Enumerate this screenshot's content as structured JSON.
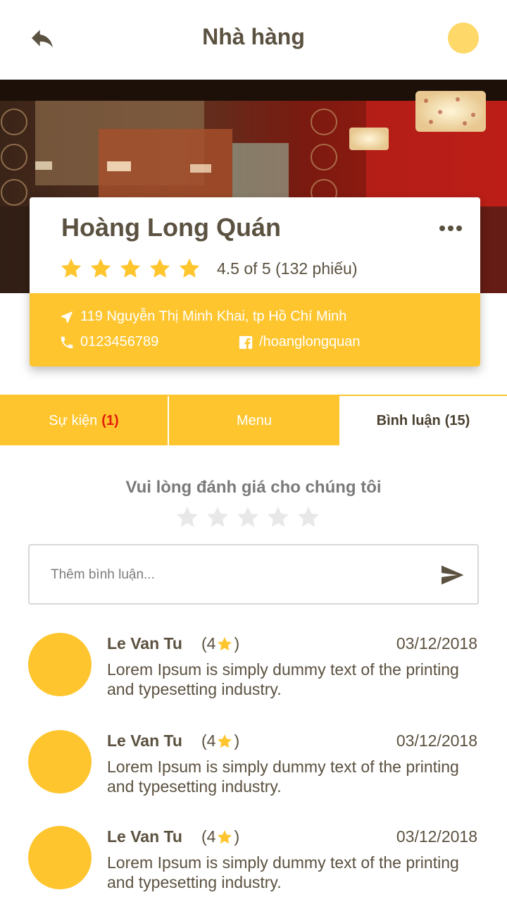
{
  "header": {
    "title": "Nhà hàng",
    "back_icon": "reply-arrow-icon",
    "avatar_color": "#fed868"
  },
  "restaurant": {
    "name": "Hoàng Long Quán",
    "rating_stars": 5,
    "rating_text": "4.5 of 5 (132 phiếu)",
    "address": "119 Nguyễn Thị Minh Khai, tp Hồ Chí Minh",
    "phone": "0123456789",
    "facebook": "/hoanglongquan"
  },
  "tabs": [
    {
      "label": "Sự kiện",
      "count": "(1)",
      "active": false
    },
    {
      "label": "Menu",
      "count": "",
      "active": false
    },
    {
      "label": "Bình luận",
      "count": "(15)",
      "active": true
    }
  ],
  "rate": {
    "title": "Vui lòng đánh giá cho chúng tôi",
    "selected_stars": 0,
    "max_stars": 5
  },
  "comment": {
    "placeholder": "Thêm bình luận..."
  },
  "reviews": [
    {
      "name": "Le Van Tu",
      "score_open": "(4",
      "score_close": ")",
      "date": "03/12/2018",
      "text": "Lorem Ipsum is simply dummy text of the printing and typesetting industry."
    },
    {
      "name": "Le Van Tu",
      "score_open": "(4",
      "score_close": ")",
      "date": "03/12/2018",
      "text": "Lorem Ipsum is simply dummy text of the printing and typesetting industry."
    },
    {
      "name": "Le Van Tu",
      "score_open": "(4",
      "score_close": ")",
      "date": "03/12/2018",
      "text": "Lorem Ipsum is simply dummy text of the printing and typesetting industry."
    }
  ],
  "colors": {
    "accent": "#fec52e",
    "text": "#5b5140",
    "highlight_red": "#e21d0d"
  }
}
